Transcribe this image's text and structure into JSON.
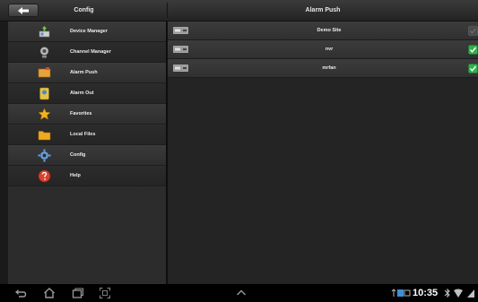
{
  "header": {
    "left_title": "Config",
    "right_title": "Alarm Push",
    "back_icon": "back-arrow-icon"
  },
  "sidebar": {
    "items": [
      {
        "label": "Device Manager",
        "icon": "device-manager-icon"
      },
      {
        "label": "Channel Manager",
        "icon": "channel-manager-icon"
      },
      {
        "label": "Alarm Push",
        "icon": "alarm-push-icon"
      },
      {
        "label": "Alarm Out",
        "icon": "alarm-out-icon"
      },
      {
        "label": "Favorites",
        "icon": "star-icon"
      },
      {
        "label": "Local Files",
        "icon": "folder-icon"
      },
      {
        "label": "Config",
        "icon": "gear-icon"
      },
      {
        "label": "Help",
        "icon": "help-icon"
      }
    ]
  },
  "alarm_push": {
    "devices": [
      {
        "name": "Demo Site",
        "checked": false
      },
      {
        "name": "nvr",
        "checked": true
      },
      {
        "name": "mrfan",
        "checked": true
      }
    ]
  },
  "system_bar": {
    "time": "10:35"
  },
  "colors": {
    "check_green": "#2db34a",
    "header_dark": "#232323",
    "text_light": "#ececec"
  }
}
